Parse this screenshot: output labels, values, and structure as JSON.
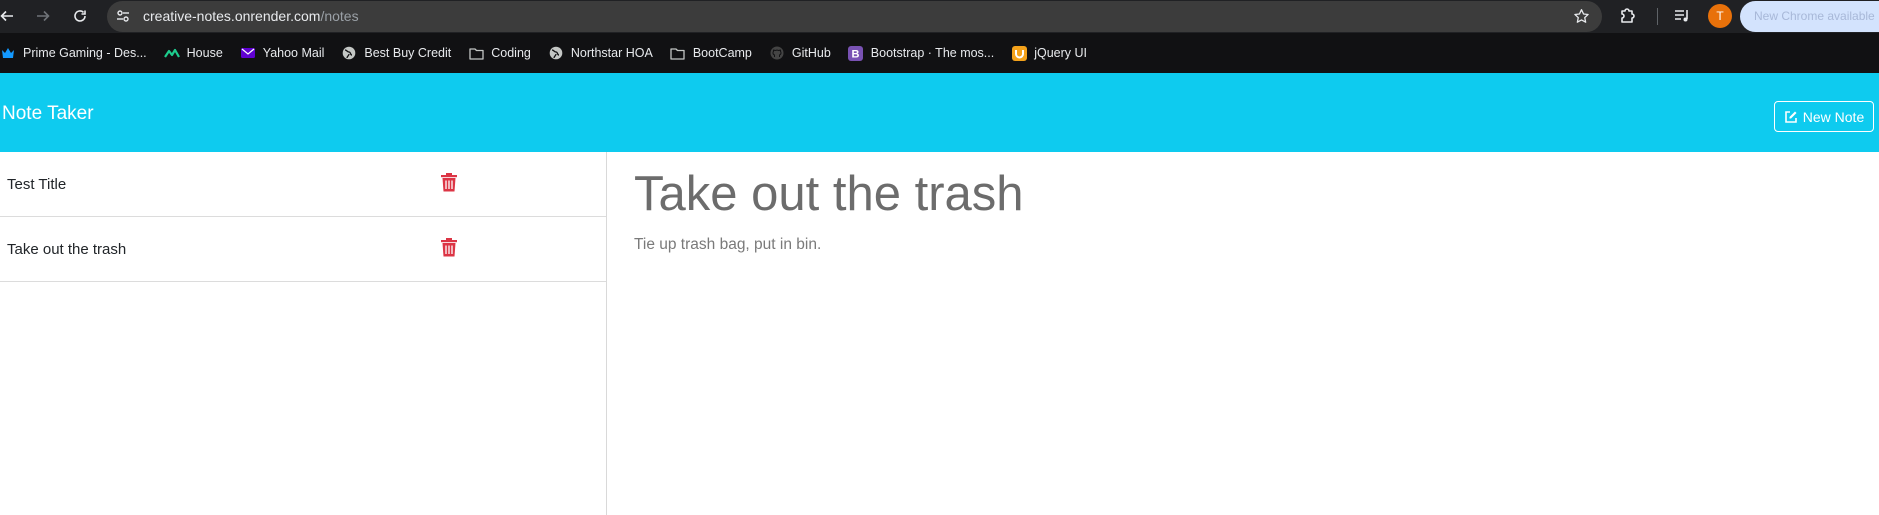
{
  "browser": {
    "url_host": "creative-notes.onrender.com",
    "url_path": "/notes",
    "profile_initial": "T",
    "update_label": "New Chrome available"
  },
  "bookmarks": [
    {
      "label": "Prime Gaming - Des...",
      "icon": "crown-icon",
      "color": "#1399ff"
    },
    {
      "label": "House",
      "icon": "zillow-icon",
      "color": "#1dcc8d"
    },
    {
      "label": "Yahoo Mail",
      "icon": "mail-icon",
      "color": "#6001d2"
    },
    {
      "label": "Best Buy Credit",
      "icon": "globe-icon",
      "color": "#c4c7c5"
    },
    {
      "label": "Coding",
      "icon": "folder-icon",
      "color": "#c4c7c5"
    },
    {
      "label": "Northstar HOA",
      "icon": "globe-icon",
      "color": "#c4c7c5"
    },
    {
      "label": "BootCamp",
      "icon": "folder-icon",
      "color": "#c4c7c5"
    },
    {
      "label": "GitHub",
      "icon": "github-icon",
      "color": "#444444"
    },
    {
      "label": "Bootstrap · The mos...",
      "icon": "bootstrap-icon",
      "color": "#7952b3"
    },
    {
      "label": "jQuery UI",
      "icon": "jquery-icon",
      "color": "#f4a21b"
    }
  ],
  "app": {
    "brand": "Note Taker",
    "new_note_label": "New Note",
    "accent_color": "#0ecbef",
    "delete_color": "#dc3545"
  },
  "notes": [
    {
      "title": "Test Title"
    },
    {
      "title": "Take out the trash"
    }
  ],
  "active_note": {
    "title": "Take out the trash",
    "text": "Tie up trash bag, put in bin."
  }
}
